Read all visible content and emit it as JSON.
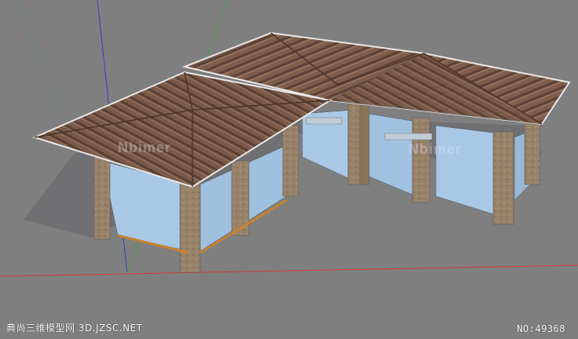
{
  "watermark": "Nbimer",
  "footer": {
    "site_label": "典尚三维模型网 3D.JZSC.NET",
    "model_number": "NO:49368"
  },
  "colors": {
    "background": "#7f7f80",
    "roof": "#7a5a48",
    "glass": "#a8c8e6",
    "column": "#9a8466",
    "frame": "#c8822f",
    "axis_red": "#d23a3a",
    "axis_green": "#3aa64a",
    "axis_blue": "#3a3ad2"
  }
}
